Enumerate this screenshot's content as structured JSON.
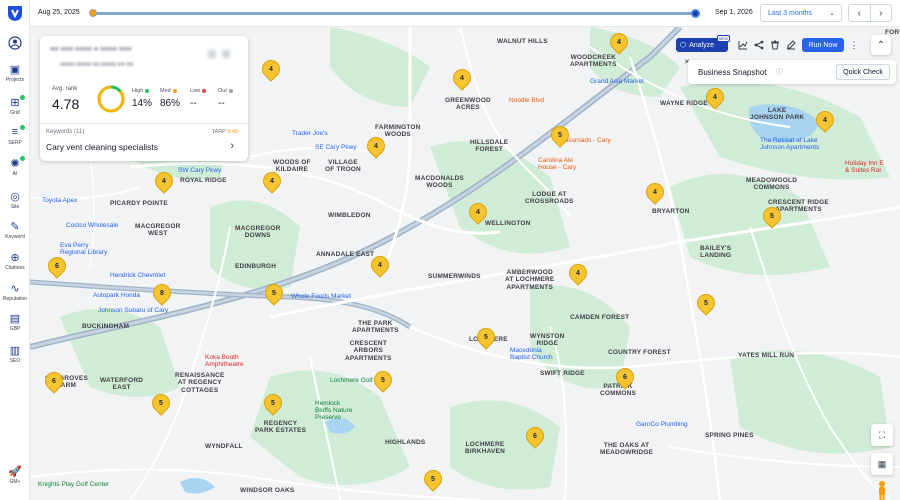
{
  "timeline": {
    "start_date": "Aug 25, 2025",
    "end_date": "Sep 1, 2026",
    "range_select": "Last 3 months"
  },
  "sidebar": {
    "items": [
      {
        "label": "Projects",
        "icon": "folder-icon"
      },
      {
        "label": "Grid",
        "icon": "grid-icon"
      },
      {
        "label": "SERP",
        "icon": "serp-icon"
      },
      {
        "label": "AI",
        "icon": "ai-icon"
      },
      {
        "label": "Site",
        "icon": "site-icon"
      },
      {
        "label": "Keyword",
        "icon": "keyword-icon"
      },
      {
        "label": "Citations",
        "icon": "citations-icon"
      },
      {
        "label": "Reputation",
        "icon": "reputation-icon"
      },
      {
        "label": "GBP",
        "icon": "gbp-icon"
      },
      {
        "label": "SEO",
        "icon": "seo-icon"
      },
      {
        "label": "GM+",
        "icon": "gm-icon"
      }
    ]
  },
  "card": {
    "avg_rank_label": "Avg. rank",
    "avg_rank_value": "4.78",
    "donut_fraction": 0.86,
    "stats": [
      {
        "label": "High",
        "value": "14%",
        "color": "#22c55e"
      },
      {
        "label": "Med",
        "value": "86%",
        "color": "#f59e0b"
      },
      {
        "label": "Low",
        "value": "--",
        "color": "#ef4444"
      },
      {
        "label": "Out",
        "value": "--",
        "color": "#9ca3af"
      }
    ],
    "keywords_label": "Keywords (11)",
    "tarp_label": "TARP",
    "tarp_value": "9.49",
    "keyword": "Cary vent cleaning specialists"
  },
  "toolbar": {
    "analyze_label": "Analyze",
    "new_badge": "NEW",
    "run_now_label": "Run Now"
  },
  "snapshot": {
    "title": "Business Snapshot",
    "quick_check_label": "Quick Check"
  },
  "map": {
    "areas": [
      "WALNUT HILLS",
      "WOODCREEK\nAPARTMENTS",
      "GREENWOOD\nACRES",
      "WAYNE RIDGE",
      "FARMINGTON\nWOODS",
      "HILLSDALE\nFOREST",
      "WOODS OF\nKILDAIRE",
      "VILLAGE\nOF TROON",
      "MACDONALDS\nWOODS",
      "ROYAL RIDGE",
      "PICARDY POINTE",
      "MACGREGOR\nWEST",
      "MACGREGOR\nDOWNS",
      "WIMBLEDON",
      "LODGE AT\nCROSSROADS",
      "WELLINGTON",
      "MEADOWGOLD\nCOMMONS",
      "CRESCENT RIDGE\nAPARTMENTS",
      "BRYARTON",
      "BAILEY'S\nLANDING",
      "EDINBURGH",
      "ANNADALE EAST",
      "SUMMERWINDS",
      "AMBERWOOD\nAT LOCHMERE\nAPARTMENTS",
      "BUCKINGHAM",
      "CAMDEN FOREST",
      "THE PARK\nAPARTMENTS",
      "CRESCENT\nARBORS\nAPARTMENTS",
      "LOCHMERE",
      "WYNSTON\nRIDGE",
      "SWIFT RIDGE",
      "COUNTRY FOREST",
      "YATES MILL RUN",
      "SEAGROVES\nFARM",
      "WATERFORD\nEAST",
      "RENAISSANCE\nAT REGENCY\nCOTTAGES",
      "PATRICK\nCOMMONS",
      "REGENCY\nPARK ESTATES",
      "WYNDFALL",
      "HIGHLANDS",
      "LOCHMERE\nBIRKHAVEN",
      "THE OAKS AT\nMEADOWRIDGE",
      "SPRING PINES",
      "WINDSOR OAKS",
      "FOREST",
      "LAKE\nJOHNSON PARK"
    ],
    "pois": [
      "Noodle Blvd",
      "Trader Joe's",
      "Grand Asia Market",
      "Crossroads - Cary",
      "Carolina Ale\nHouse - Cary",
      "Costco Wholesale",
      "Eva Perry\nRegional Library",
      "Hendrick Chevrolet",
      "Autopark Honda",
      "Johnson Subaru of Cary",
      "Whole Foods Market",
      "Koka Booth\nAmphitheatre",
      "Lochmere Golf Club",
      "Hemlock\nBluffs Nature\nPreserve",
      "Macedonia\nBaptist Church",
      "The Retreat at Lake\nJohnson Apartments",
      "Holiday Inn E\n& Suites Ral",
      "GarnCo Plumbing",
      "Knights Play Golf Center",
      "Toyota Apex",
      "SE Cary Pkwy",
      "SW Cary Pkwy"
    ],
    "pins": [
      "4",
      "4",
      "4",
      "4",
      "4",
      "5",
      "4",
      "4",
      "4",
      "4",
      "5",
      "4",
      "6",
      "4",
      "8",
      "5",
      "4",
      "5",
      "5",
      "6",
      "5",
      "5",
      "5",
      "6",
      "5",
      "6"
    ]
  },
  "colors": {
    "accent": "#2563eb",
    "pin": "#f6c431",
    "brand": "#1e40af"
  }
}
